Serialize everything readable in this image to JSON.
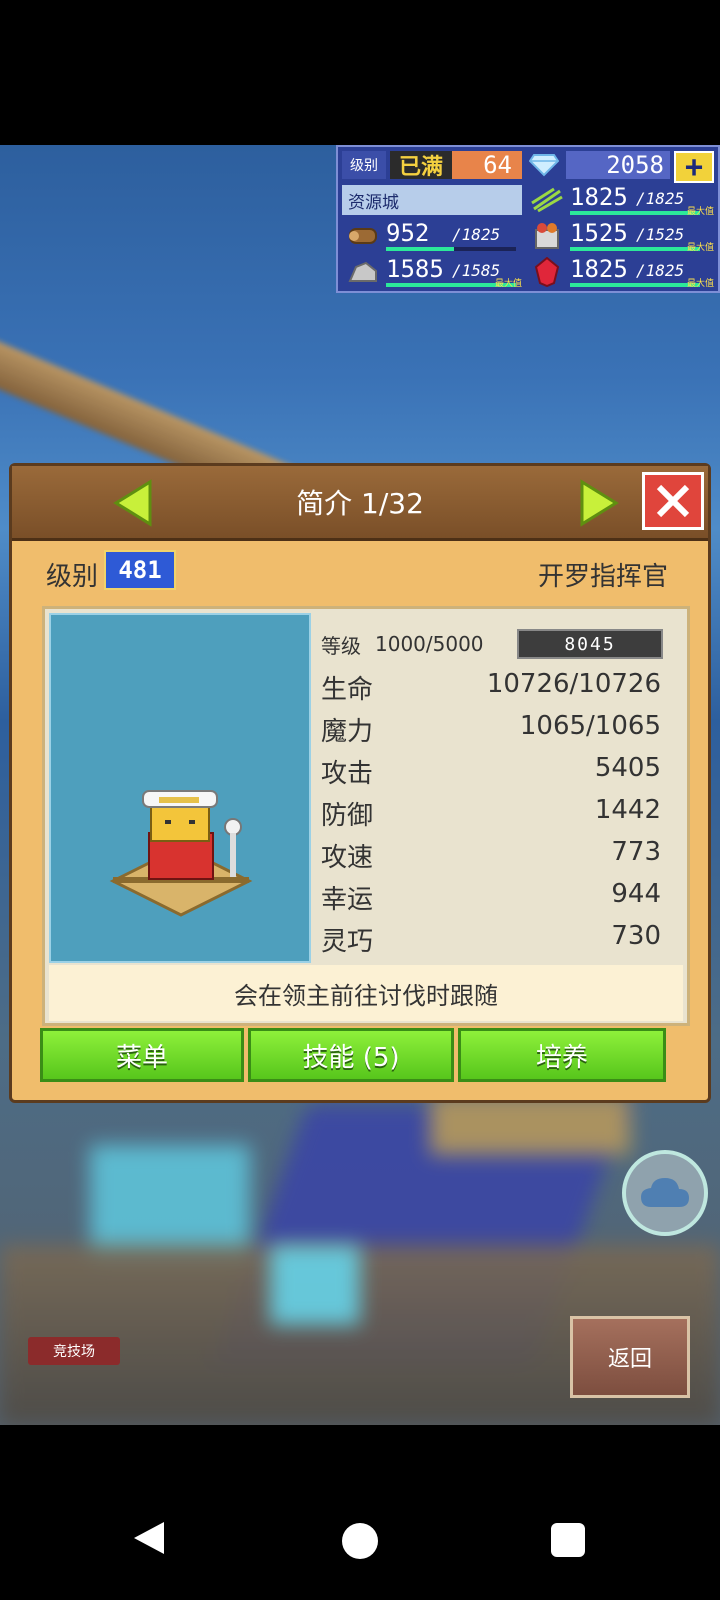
{
  "status_panel": {
    "level_label": "级别",
    "level_full": "已满",
    "level_value": "64",
    "gems": "2058",
    "plus_label": "+",
    "city_name": "资源城",
    "resources": [
      {
        "icon": "grain-icon",
        "value": "1825",
        "max": "/1825",
        "cap_label": "最大值",
        "fill": 1.0
      },
      {
        "icon": "wood-icon",
        "value": "952",
        "max": "/1825",
        "cap_label": "",
        "fill": 0.52
      },
      {
        "icon": "food-icon",
        "value": "1525",
        "max": "/1525",
        "cap_label": "最大值",
        "fill": 1.0
      },
      {
        "icon": "ore-icon",
        "value": "1585",
        "max": "/1585",
        "cap_label": "最大值",
        "fill": 1.0
      },
      {
        "icon": "ruby-icon",
        "value": "1825",
        "max": "/1825",
        "cap_label": "最大值",
        "fill": 1.0
      }
    ]
  },
  "dialog": {
    "title": "简介 1/32",
    "level_label": "级别",
    "level_value": "481",
    "hero_name": "开罗指挥官",
    "exp_label": "等级",
    "exp_value": "1000/5000",
    "exp_bar_value": "8045",
    "stats": [
      {
        "label": "生命",
        "value": "10726/10726"
      },
      {
        "label": "魔力",
        "value": "1065/1065"
      },
      {
        "label": "攻击",
        "value": "5405"
      },
      {
        "label": "防御",
        "value": "1442"
      },
      {
        "label": "攻速",
        "value": "773"
      },
      {
        "label": "幸运",
        "value": "944"
      },
      {
        "label": "灵巧",
        "value": "730"
      }
    ],
    "description": "会在领主前往讨伐时跟随",
    "buttons": {
      "menu": "菜单",
      "skills": "技能 (5)",
      "train": "培养"
    }
  },
  "arena_tag": "竞技场",
  "back_label": "返回",
  "colors": {
    "accent_green": "#6fdc2a",
    "close_red": "#e0453c",
    "panel_blue": "#2c3f95"
  }
}
